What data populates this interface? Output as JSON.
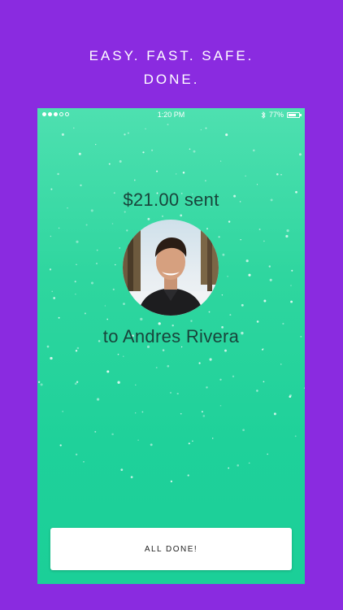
{
  "headline": {
    "line1": "EASY. FAST. SAFE.",
    "line2": "DONE."
  },
  "status_bar": {
    "time": "1:20 PM",
    "battery_percent": "77%",
    "battery_level": 0.77,
    "signal_bars_filled": 3,
    "signal_bars_total": 5,
    "bluetooth_icon": "bluetooth-icon"
  },
  "payment": {
    "amount_text": "$21.00 sent",
    "recipient_text": "to Andres Rivera"
  },
  "actions": {
    "done_label": "ALL DONE!"
  },
  "colors": {
    "outer_background": "#8a2be0",
    "screen_gradient_top": "#4ee0b0",
    "screen_gradient_bottom": "#1bcf98",
    "text_dark": "#18443b",
    "button_background": "#ffffff"
  }
}
